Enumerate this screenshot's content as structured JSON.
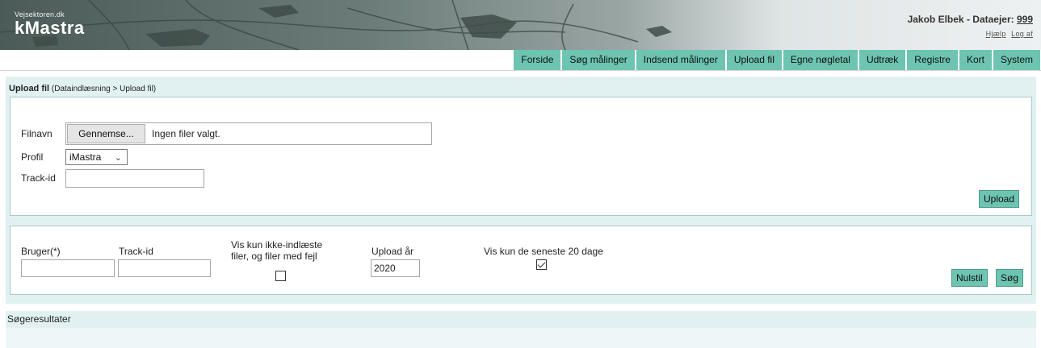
{
  "brand": {
    "small": "Vejsektoren.dk",
    "name": "kMastra"
  },
  "user": {
    "name_prefix": "Jakob Elbek - Dataejer: ",
    "owner_id": "999",
    "help": "Hjælp",
    "logout": "Log af"
  },
  "nav": [
    "Forside",
    "Søg målinger",
    "Indsend målinger",
    "Upload fil",
    "Egne nøgletal",
    "Udtræk",
    "Registre",
    "Kort",
    "System"
  ],
  "page": {
    "title": "Upload fil",
    "breadcrumb": "(Dataindlæsning > Upload fil)"
  },
  "upload_form": {
    "filename_label": "Filnavn",
    "browse_label": "Gennemse...",
    "file_status": "Ingen filer valgt.",
    "profile_label": "Profil",
    "profile_value": "iMastra",
    "trackid_label": "Track-id",
    "trackid_value": "",
    "upload_button": "Upload"
  },
  "search_form": {
    "user_label": "Bruger(*)",
    "user_value": "",
    "trackid_label": "Track-id",
    "trackid_value": "",
    "not_loaded_label_1": "Vis kun ikke-indlæste",
    "not_loaded_label_2": "filer, og filer med fejl",
    "not_loaded_checked": false,
    "year_label": "Upload år",
    "year_value": "2020",
    "recent_label": "Vis kun de seneste 20 dage",
    "recent_checked": true,
    "reset_button": "Nulstil",
    "search_button": "Søg"
  },
  "results": {
    "title": "Søgeresultater"
  },
  "colors": {
    "accent": "#6dc4b1",
    "panel": "#e1f1f1",
    "header_dark": "#4a5b58"
  }
}
